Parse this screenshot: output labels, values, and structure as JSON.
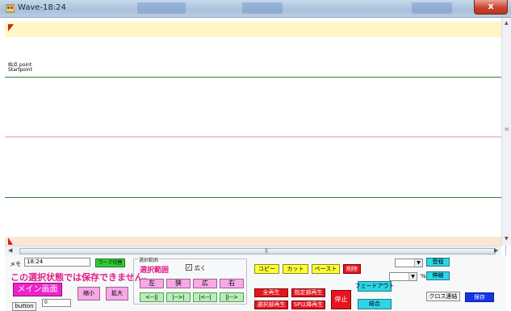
{
  "window": {
    "title": "Wave-18:24",
    "close_label": "x"
  },
  "wave": {
    "start_point_label_jp": "始点 point",
    "start_point_label_en": "Startpoint"
  },
  "panel": {
    "memo_label": "メモ",
    "memo_value": "18:24",
    "work_switch_label": "ワーク切替",
    "warning_text": "この選択状態では保存できません。",
    "main_screen_label": "メイン画面",
    "shrink_label": "縮小",
    "expand_label": "拡大",
    "small_input_value": "0",
    "tooltip_label": "button",
    "range_group_caption": "選択範囲",
    "range_label": "選択範囲",
    "widen_checked": true,
    "widen_label": "広く",
    "nav_buttons": [
      "左",
      "狭",
      "広",
      "右"
    ],
    "step_buttons": [
      "<--||",
      "|-->|",
      "|<--|",
      "||-->"
    ],
    "copy_label": "コピー",
    "cut_label": "カット",
    "paste_label": "ペースト",
    "delete_label": "削除",
    "play_all_label": "全再生",
    "play_range_label": "指定部再生",
    "play_sel_label": "選択部再生",
    "play_sp_label": "SP以降再生",
    "stop_label": "停止",
    "fadeout_label": "フェードアウト",
    "join_label": "結合",
    "percent_label": "%",
    "pitch_label": "音程",
    "speed_label": "伸縮",
    "crossfade_label": "クロス連結",
    "save_label": "保存"
  },
  "colors": {
    "main_screen": "#ee22cc",
    "warning": "#e0218a",
    "save": "#1234e8",
    "cyan": "#2cd5e8",
    "red": "#e6141e"
  }
}
